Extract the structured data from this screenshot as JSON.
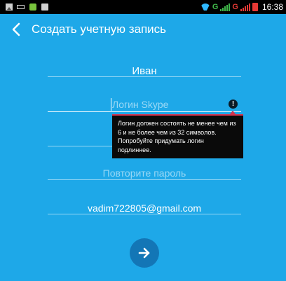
{
  "status_bar": {
    "time": "16:38",
    "icons": [
      "gallery-icon",
      "usb-icon",
      "app-cube-icon",
      "shopping-bag-icon",
      "wifi-icon",
      "signal-icon",
      "battery-icon"
    ],
    "network_label_1": "G",
    "network_label_2": "G"
  },
  "header": {
    "title": "Создать учетную запись",
    "back_icon": "chevron-left-icon"
  },
  "form": {
    "name_value": "Иван",
    "login_placeholder": "Логин Skype",
    "login_error_tooltip": "Логин должен состоять не менее чем из 6 и не более чем из 32 символов. Попробуйте придумать логин подлиннее.",
    "confirm_password_placeholder": "Повторите пароль",
    "email_value": "vadim722805@gmail.com",
    "next_icon": "arrow-right-icon"
  },
  "colors": {
    "background": "#1ea8e8",
    "next_button": "#1376b6",
    "tooltip_background": "#0a0a0a",
    "error_accent": "#d6334d"
  }
}
